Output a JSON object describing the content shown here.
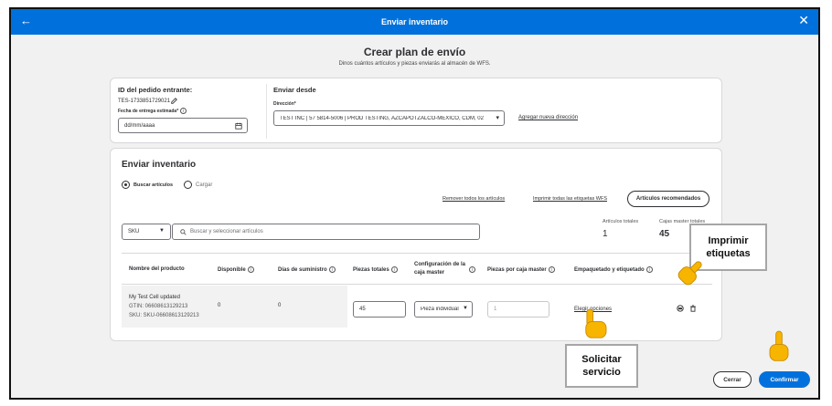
{
  "header": {
    "title": "Enviar inventario",
    "back_icon": "arrow-left-icon",
    "close_icon": "close-icon",
    "color": "#0071dc"
  },
  "intro": {
    "title": "Crear plan de envío",
    "subtitle": "Dinos cuántos artículos y piezas enviarás al almacén de WFS."
  },
  "order": {
    "label": "ID del pedido entrante:",
    "id": "TES-1733851729021",
    "date_label": "Fecha de entrega estimada*",
    "date_placeholder": "dd/mm/aaaa"
  },
  "ship_from": {
    "label": "Enviar desde",
    "address_label": "Dirección*",
    "address_value": "TEST INC | 57 5814-5006 | PROD TESTING, AZCAPOTZALCO-MEXICO, CDM, 02",
    "add_link": "Agregar nueva dirección"
  },
  "inventory": {
    "title": "Enviar inventario",
    "options": [
      "Buscar artículos",
      "Cargar"
    ],
    "remove_all": "Remover todos los artículos",
    "print_all": "Imprimir todas las etiquetas WFS",
    "recommended": "Artículos recomendados",
    "search_type": "SKU",
    "search_placeholder": "Buscar y seleccionar artículos",
    "totals": {
      "items_label": "Artículos totales",
      "items_value": "1",
      "boxes_label": "Cajas master totales",
      "boxes_value": "45"
    }
  },
  "table": {
    "columns": [
      "Nombre del producto",
      "Disponible",
      "Días de suministro",
      "Piezas totales",
      "Configuración de la caja master",
      "Piezas por caja master",
      "Empaquetado y etiquetado"
    ],
    "rows": [
      {
        "name": "My Test Cell updated",
        "gtin": "GTIN: 06608613129213",
        "sku": "SKU: SKU-06608613129213",
        "available": "0",
        "supply_days": "0",
        "total_pieces": "45",
        "box_config": "Pieza individual",
        "pieces_per_box": "1",
        "service_link": "Elegir opciones"
      }
    ]
  },
  "callouts": {
    "print_labels": "Imprimir etiquetas",
    "request_service": "Solicitar servicio"
  },
  "footer": {
    "cancel": "Cerrar",
    "confirm": "Confirmar"
  }
}
